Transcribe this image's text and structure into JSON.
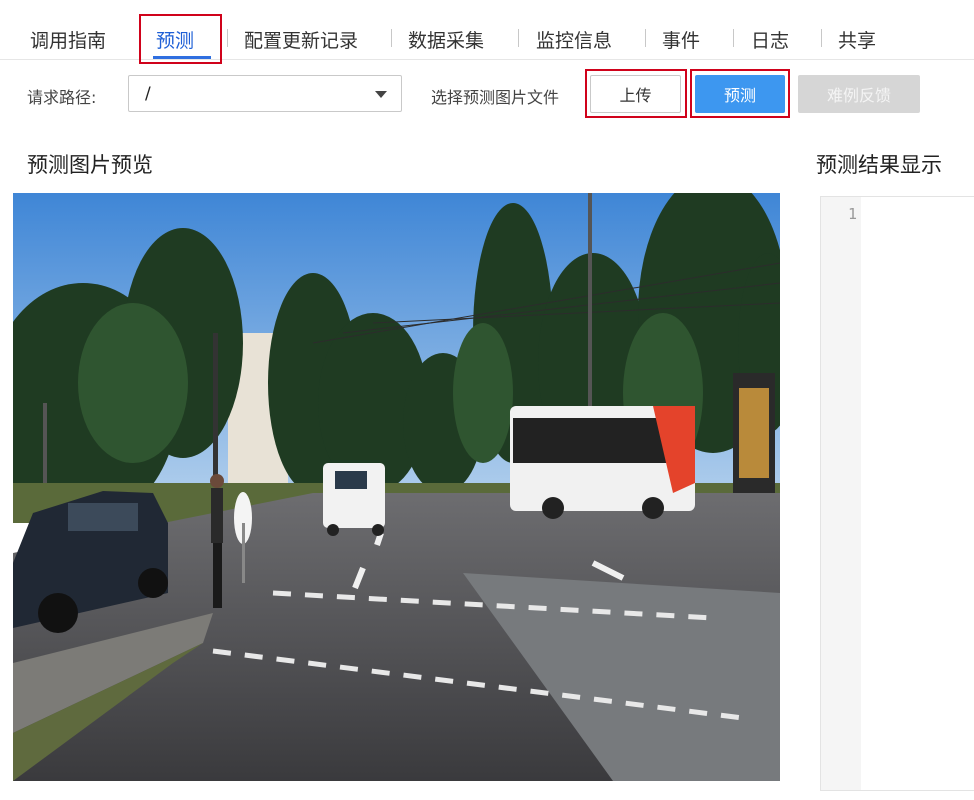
{
  "tabs": [
    {
      "label": "调用指南"
    },
    {
      "label": "预测",
      "active": true
    },
    {
      "label": "配置更新记录"
    },
    {
      "label": "数据采集"
    },
    {
      "label": "监控信息"
    },
    {
      "label": "事件"
    },
    {
      "label": "日志"
    },
    {
      "label": "共享"
    }
  ],
  "toolbar": {
    "path_label": "请求路径:",
    "path_value": "/",
    "file_label": "选择预测图片文件",
    "upload_label": "上传",
    "predict_label": "预测",
    "feedback_label": "难例反馈"
  },
  "preview": {
    "title": "预测图片预览",
    "image_icon": "street-scene-photo"
  },
  "result": {
    "title": "预测结果显示",
    "line_numbers": [
      "1"
    ]
  },
  "colors": {
    "active_tab": "#1e5fd6",
    "primary_button": "#3d97f0",
    "disabled_button": "#d6d6d6",
    "highlight_box": "#d0021b"
  }
}
